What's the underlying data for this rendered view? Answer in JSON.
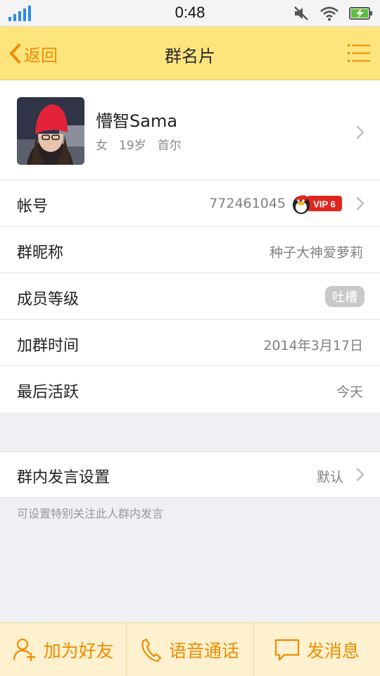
{
  "status_bar": {
    "time": "0:48"
  },
  "nav": {
    "back_label": "返回",
    "title": "群名片"
  },
  "profile": {
    "name": "懵智Sama",
    "gender": "女",
    "age": "19岁",
    "location": "首尔"
  },
  "info": {
    "account_label": "帐号",
    "account_value": "772461045",
    "vip_badge": "VIP 6",
    "nickname_label": "群昵称",
    "nickname_value": "种子大神爱萝莉",
    "level_label": "成员等级",
    "level_value": "吐槽",
    "join_label": "加群时间",
    "join_value": "2014年3月17日",
    "active_label": "最后活跃",
    "active_value": "今天"
  },
  "settings": {
    "label": "群内发言设置",
    "value": "默认",
    "hint": "可设置特别关注此人群内发言"
  },
  "bottom": {
    "add_friend": "加为好友",
    "voice_call": "语音通话",
    "send_message": "发消息"
  },
  "colors": {
    "accent": "#f08c00",
    "navbar": "#fde47d",
    "bottombar": "#fdf1cf"
  }
}
